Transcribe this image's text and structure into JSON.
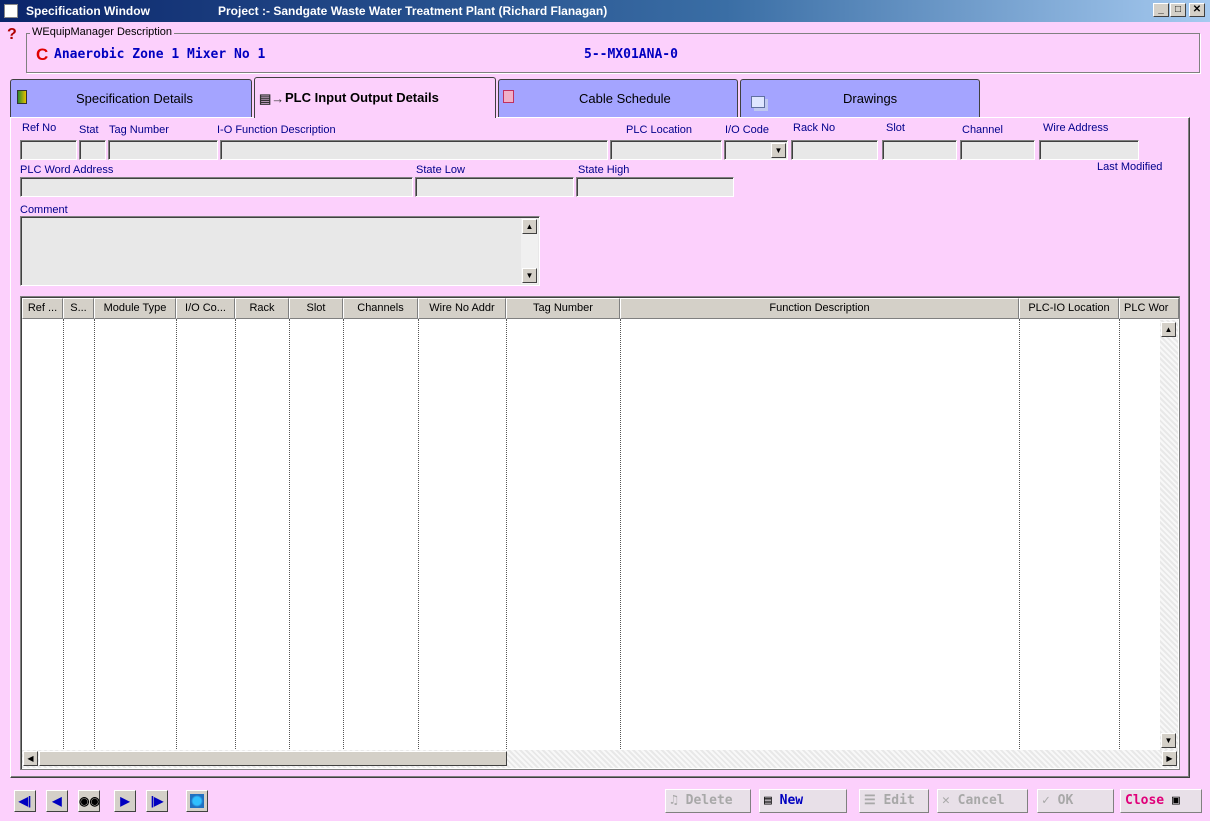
{
  "window": {
    "title": "Specification Window",
    "project": "Project :- Sandgate Waste Water Treatment Plant (Richard Flanagan)",
    "min": "_",
    "max": "□",
    "close": "✕"
  },
  "description_group": {
    "label": "WEquipManager Description",
    "help_glyph": "?",
    "status_glyph": "C",
    "description": "Anaerobic Zone 1 Mixer No 1",
    "code": "5--MX01ANA-0"
  },
  "tabs": [
    {
      "label": "Specification Details",
      "icon": "book-icon"
    },
    {
      "label": "PLC Input Output Details",
      "icon": "plc-io-icon",
      "active": true
    },
    {
      "label": "Cable Schedule",
      "icon": "cable-icon"
    },
    {
      "label": "Drawings",
      "icon": "drawings-icon"
    }
  ],
  "form": {
    "ref_no": "Ref No",
    "stat": "Stat",
    "tag_number": "Tag Number",
    "io_function": "I-O Function Description",
    "plc_location": "PLC Location",
    "io_code": "I/O Code",
    "rack_no": "Rack No",
    "slot": "Slot",
    "channel": "Channel",
    "wire_address": "Wire Address",
    "plc_word_address": "PLC Word Address",
    "state_low": "State Low",
    "state_high": "State High",
    "last_modified": "Last Modified",
    "comment": "Comment"
  },
  "grid": {
    "columns": [
      "Ref ...",
      "S...",
      "Module Type",
      "I/O Co...",
      "Rack",
      "Slot",
      "Channels",
      "Wire No Addr",
      "Tag Number",
      "Function Description",
      "PLC-IO Location",
      "PLC Wor"
    ],
    "rows": []
  },
  "navigation": [
    "first-record-icon",
    "previous-record-icon",
    "find-icon",
    "next-record-icon",
    "last-record-icon",
    "refresh-icon"
  ],
  "actions": {
    "delete": "Delete",
    "new": "New",
    "edit": "Edit",
    "cancel": "Cancel",
    "ok": "OK",
    "close": "Close"
  },
  "colors": {
    "background": "#fcd0fc",
    "tab": "#a4a4ff",
    "title_start": "#0a246a",
    "label_blue": "#00008b",
    "close_pink": "#e0007a"
  }
}
